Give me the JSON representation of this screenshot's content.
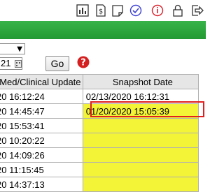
{
  "toolbar": {
    "icons": [
      "chart-icon",
      "dollar-document-icon",
      "note-icon",
      "check-circle-icon",
      "info-circle-icon",
      "lock-icon",
      "logout-icon"
    ]
  },
  "filter": {
    "select_value": "",
    "date_value": "21",
    "go_label": "Go"
  },
  "table": {
    "headers": [
      "Med/Clinical Update",
      "Snapshot Date"
    ],
    "rows": [
      [
        "20 16:12:24",
        "02/13/2020 16:12:31"
      ],
      [
        "20 14:45:47",
        "01/20/2020 15:05:39"
      ],
      [
        "20 15:53:41",
        ""
      ],
      [
        "20 10:20:22",
        ""
      ],
      [
        "20 14:09:26",
        ""
      ],
      [
        "20 11:15:45",
        ""
      ],
      [
        "20 14:37:13",
        ""
      ]
    ]
  },
  "colors": {
    "green_bar": "#28a23a",
    "highlight_cell": "#f3f337",
    "selection_outline": "#e0201e",
    "info_red": "#d9202a",
    "check_blue": "#3b3fd1"
  }
}
